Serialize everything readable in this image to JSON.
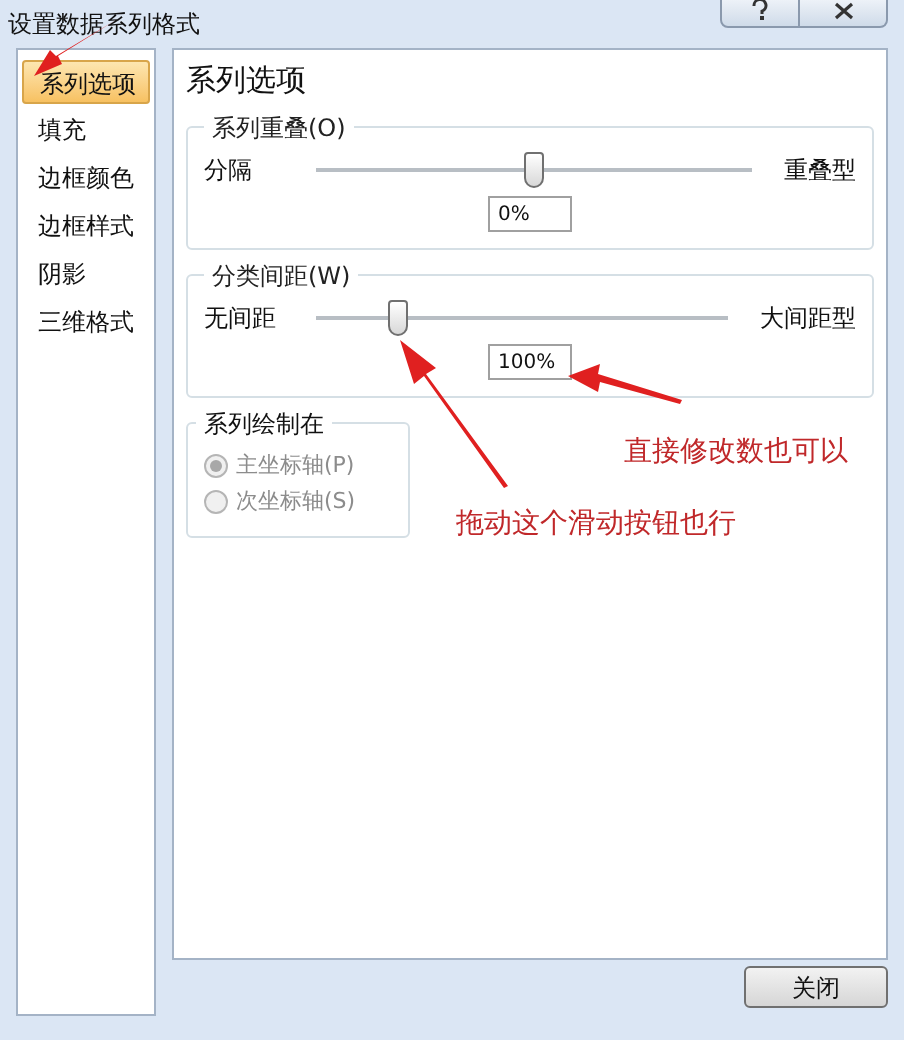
{
  "window": {
    "title": "设置数据系列格式"
  },
  "sidebar": {
    "items": [
      {
        "label": "系列选项",
        "selected": true
      },
      {
        "label": "填充",
        "selected": false
      },
      {
        "label": "边框颜色",
        "selected": false
      },
      {
        "label": "边框样式",
        "selected": false
      },
      {
        "label": "阴影",
        "selected": false
      },
      {
        "label": "三维格式",
        "selected": false
      }
    ]
  },
  "panel": {
    "heading": "系列选项",
    "sliders": [
      {
        "group": "系列重叠(O)",
        "min_label": "分隔",
        "max_label": "重叠型",
        "level": 0.5,
        "value": "0%"
      },
      {
        "group": "分类间距(W)",
        "min_label": "无间距",
        "max_label": "大间距型",
        "level": 0.2,
        "value": "100%"
      }
    ],
    "plot_on": {
      "group": "系列绘制在",
      "options": [
        {
          "label": "主坐标轴(P)",
          "selected": true,
          "disabled": true
        },
        {
          "label": "次坐标轴(S)",
          "selected": false,
          "disabled": true
        }
      ]
    }
  },
  "annotations": [
    "直接修改数也可以",
    "拖动这个滑动按钮也行"
  ],
  "buttons": [
    "关闭"
  ]
}
